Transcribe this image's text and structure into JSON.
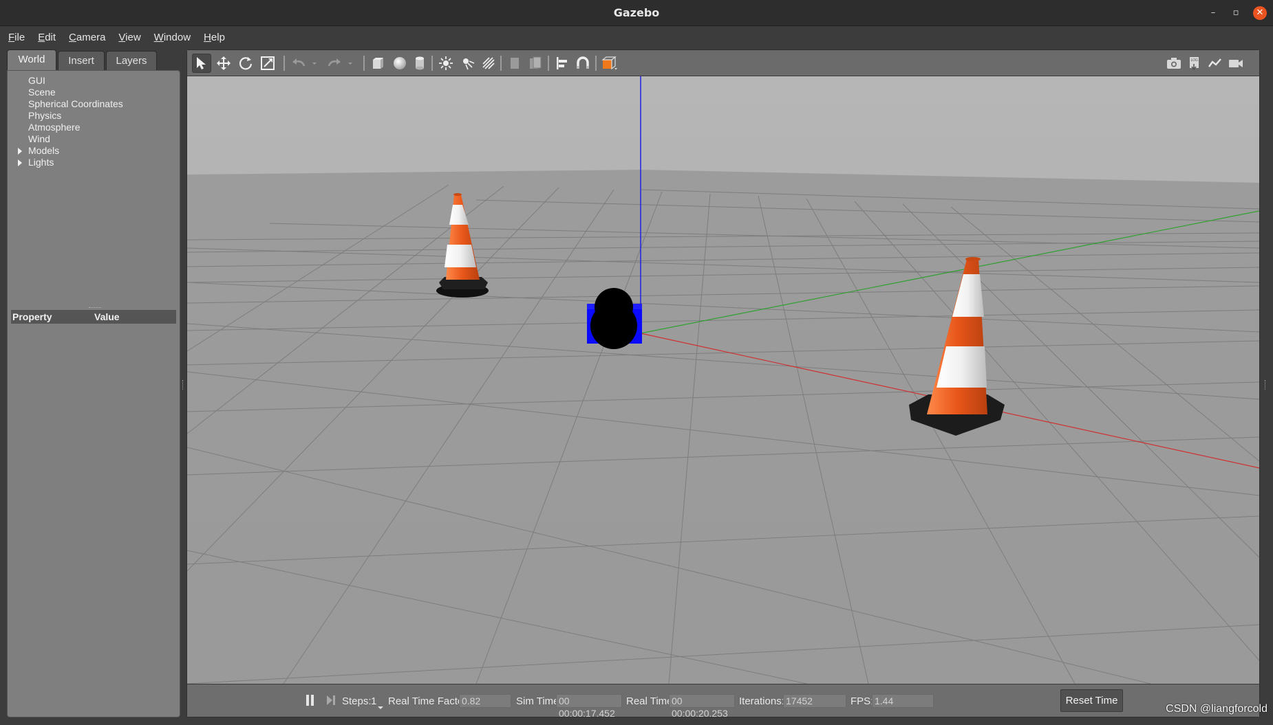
{
  "window": {
    "title": "Gazebo",
    "controls": {
      "minimize": "–",
      "restore": "▫",
      "close": "✕"
    }
  },
  "menu": {
    "items": [
      {
        "u": "F",
        "rest": "ile"
      },
      {
        "u": "E",
        "rest": "dit"
      },
      {
        "u": "C",
        "rest": "amera"
      },
      {
        "u": "V",
        "rest": "iew"
      },
      {
        "u": "W",
        "rest": "indow"
      },
      {
        "u": "H",
        "rest": "elp"
      }
    ]
  },
  "left_panel": {
    "tabs": [
      "World",
      "Insert",
      "Layers"
    ],
    "active_tab": "World",
    "tree": [
      {
        "label": "GUI",
        "expandable": false
      },
      {
        "label": "Scene",
        "expandable": false
      },
      {
        "label": "Spherical Coordinates",
        "expandable": false
      },
      {
        "label": "Physics",
        "expandable": false
      },
      {
        "label": "Atmosphere",
        "expandable": false
      },
      {
        "label": "Wind",
        "expandable": false
      },
      {
        "label": "Models",
        "expandable": true
      },
      {
        "label": "Lights",
        "expandable": true
      }
    ],
    "property_header": {
      "property": "Property",
      "value": "Value"
    }
  },
  "toolbar": {
    "tools": [
      "select-mode-icon",
      "translate-mode-icon",
      "rotate-mode-icon",
      "scale-mode-icon",
      "undo-icon",
      "redo-icon",
      "box-shape-icon",
      "sphere-shape-icon",
      "cylinder-shape-icon",
      "point-light-icon",
      "spot-light-icon",
      "directional-light-icon",
      "copy-icon",
      "paste-icon",
      "align-icon",
      "snap-icon",
      "view-angle-icon"
    ],
    "right_tools": [
      "screenshot-icon",
      "log-icon",
      "plot-icon",
      "video-record-icon"
    ],
    "accent_color": "#f07a1a"
  },
  "scene": {
    "sky_color": "#b0b0b0",
    "ground_color": "#9a9a9a",
    "axis_colors": {
      "x": "#e03030",
      "y": "#30b030",
      "z": "#2020e0"
    },
    "model_colors": {
      "box": "#0a0aff",
      "wheel": "#000000",
      "cone_orange": "#e85a1a",
      "cone_white": "#f4f4f4",
      "cone_base": "#1a1a1a"
    }
  },
  "bottom_bar": {
    "steps_label": "Steps:",
    "steps_value": "1",
    "rtf_label": "Real Time Factor:",
    "rtf_value": "0.82",
    "sim_time_label": "Sim Time:",
    "sim_time_value": "00 00:00:17.452",
    "real_time_label": "Real Time:",
    "real_time_value": "00 00:00:20.253",
    "iterations_label": "Iterations:",
    "iterations_value": "17452",
    "fps_label": "FPS:",
    "fps_value": "1.44",
    "reset_label": "Reset Time"
  },
  "watermark": "CSDN @liangforcold"
}
